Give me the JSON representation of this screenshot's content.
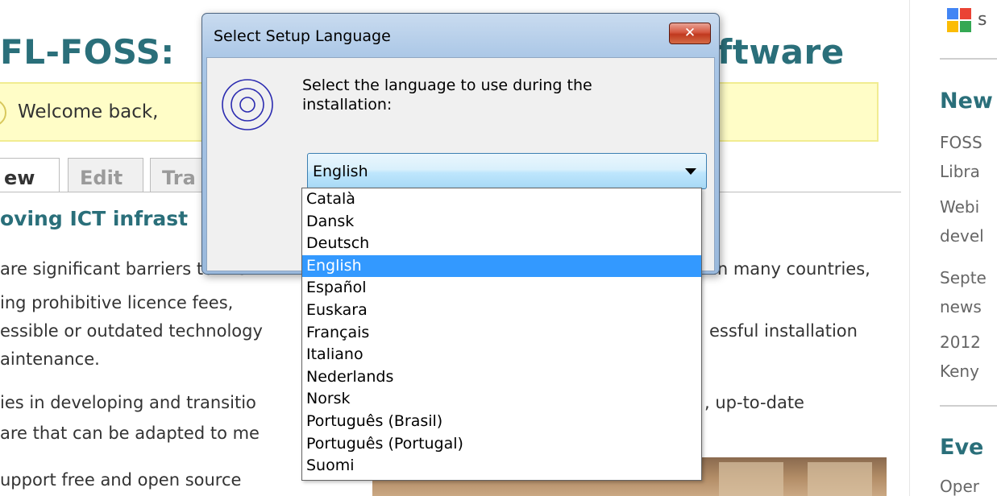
{
  "background": {
    "title_left": "FL-FOSS:",
    "title_right": "ftware",
    "welcome_text": "Welcome back, ",
    "tabs": [
      "ew",
      "Edit",
      "Tra"
    ],
    "section_heading": "oving ICT infrast",
    "paragraph_lines": [
      {
        "left": "are significant barriers to the",
        "right": "in many countries,"
      },
      {
        "left": "ing prohibitive licence fees,",
        "right": ""
      },
      {
        "left": "essible or outdated technology",
        "right": "essful installation"
      },
      {
        "left": "aintenance.",
        "right": ""
      },
      {
        "left": "ies in developing and transitio",
        "right": ", up-to-date"
      },
      {
        "left": "are that can be adapted to me",
        "right": ""
      },
      {
        "left": "upport free and open source",
        "right": ""
      }
    ]
  },
  "sidebar": {
    "logo_icon": "google-icon",
    "logo_text": "s",
    "news_heading": "New",
    "news_items": [
      "FOSS",
      "Libra",
      "Webi",
      "devel",
      "Septe",
      "news",
      "2012",
      "Keny"
    ],
    "events_heading": "Eve",
    "events_items": [
      "Oper"
    ]
  },
  "dialog": {
    "title": "Select Setup Language",
    "close_label": "✕",
    "prompt": "Select the language to use during the installation:",
    "combo_value": "English",
    "options": [
      "Català",
      "Dansk",
      "Deutsch",
      "English",
      "Español",
      "Euskara",
      "Français",
      "Italiano",
      "Nederlands",
      "Norsk",
      "Português (Brasil)",
      "Português (Portugal)",
      "Suomi"
    ],
    "selected_index": 3
  },
  "colors": {
    "accent": "#2a6f7a",
    "selection": "#3399ff",
    "welcome_bg": "#fffdc7"
  }
}
